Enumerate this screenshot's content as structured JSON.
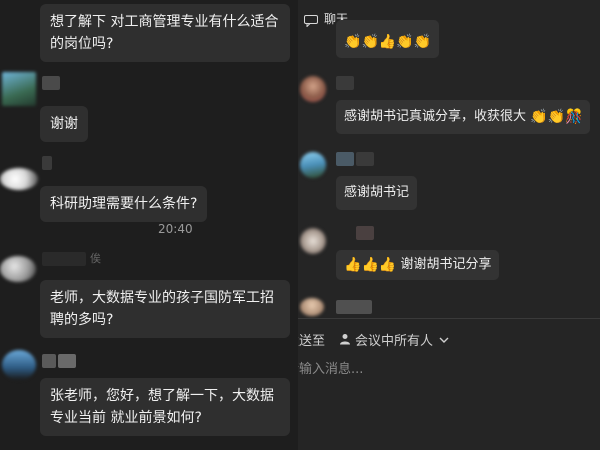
{
  "left_chat": {
    "messages": [
      {
        "text_line1": "想了解下 对工商管理专业有什么适合",
        "text_line2": "的岗位吗?"
      },
      {
        "text_line1": "谢谢"
      },
      {
        "text_line1": "科研助理需要什么条件?"
      },
      {
        "text_line1": "老师，大数据专业的孩子国防军工招",
        "text_line2": "聘的多吗?"
      },
      {
        "text_line1": "张老师，您好，想了解一下，大数据",
        "text_line2": "专业当前 就业前景如何?"
      }
    ],
    "timestamp": "20:40",
    "partial_name_glyph": "俟"
  },
  "right_panel": {
    "header_title": "聊天",
    "messages": [
      {
        "text": "感谢胡书记真诚分享，收获很大"
      },
      {
        "text": "感谢胡书记"
      },
      {
        "text": "谢谢胡书记分享"
      }
    ],
    "send_to_label": "发送至",
    "send_to_target": "会议中所有人",
    "input_placeholder": "请输入消息..."
  },
  "colors": {
    "background": "#1e1e1e",
    "bubble": "#2f2f2f",
    "panel": "#252525",
    "emoji_yellow": "#f2b53a"
  },
  "icons": [
    "chat-icon",
    "person-icon",
    "chevron-down-icon",
    "clap-emoji",
    "thumbs-up-emoji",
    "firecracker-emoji"
  ]
}
